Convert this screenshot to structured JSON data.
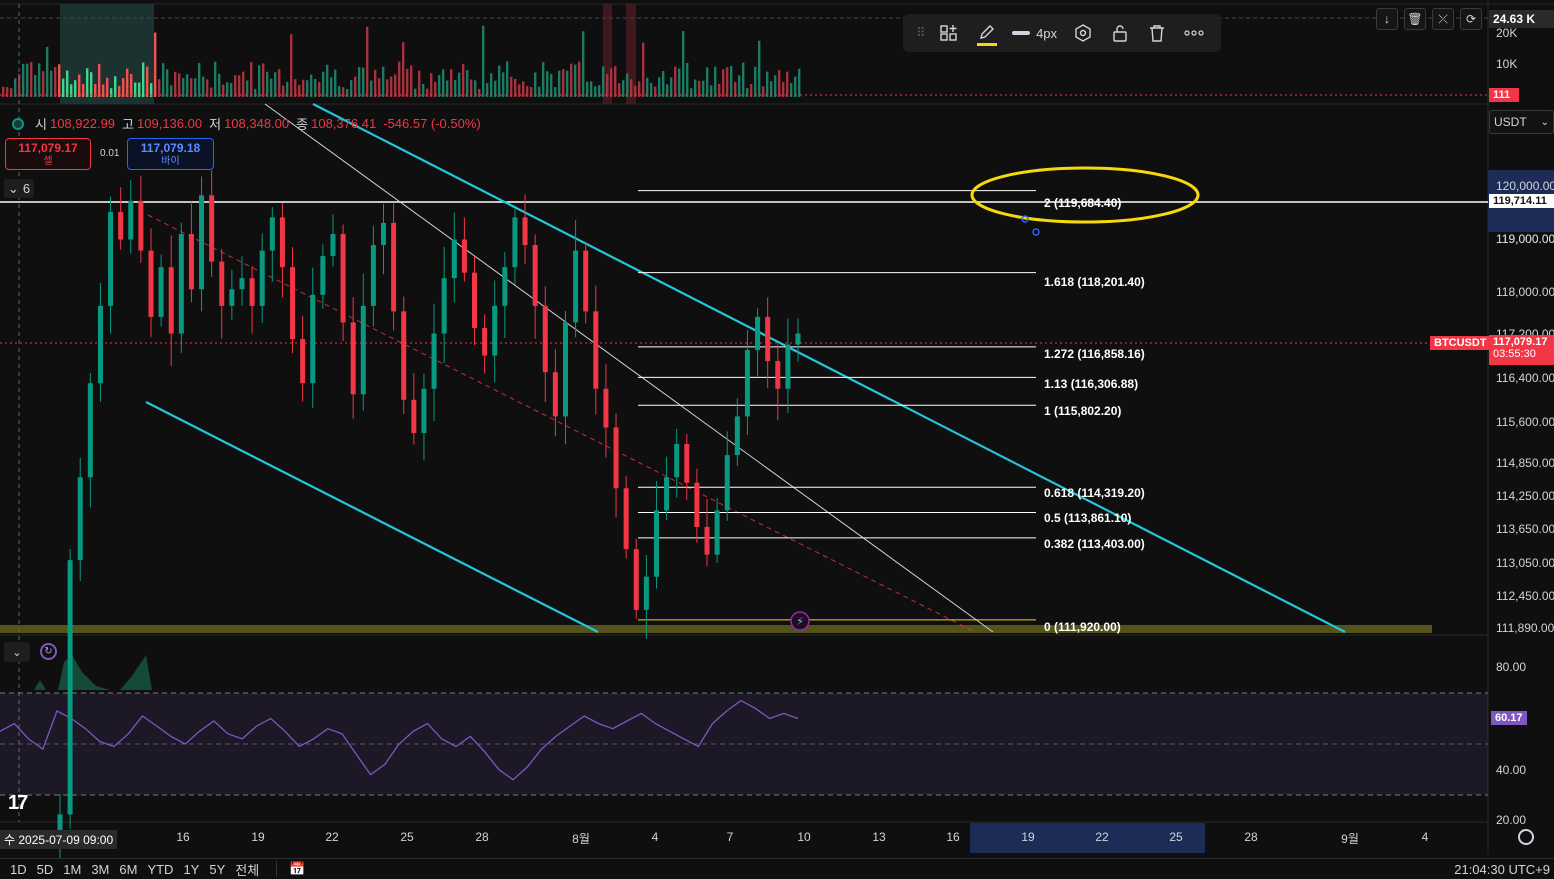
{
  "ohlc": {
    "open_label": "시",
    "open": "108,922.99",
    "high_label": "고",
    "high": "109,136.00",
    "low_label": "저",
    "low": "108,348.00",
    "close_label": "종",
    "close": "108,376.41",
    "change": "-546.57 (-0.50%)"
  },
  "trade": {
    "sell_price": "117,079.17",
    "sell_label": "셀",
    "spread": "0.01",
    "buy_price": "117,079.18",
    "buy_label": "바이"
  },
  "indicators_collapsed_count": "6",
  "drawing_toolbar": {
    "width_label": "4px",
    "tools": [
      "drag-handle",
      "template-icon",
      "pen-icon",
      "line-style-icon",
      "settings-icon",
      "lock-icon",
      "trash-icon",
      "more-icon"
    ]
  },
  "currency": "USDT",
  "symbol": "BTCUSDT",
  "last_price": "117,079.17",
  "countdown": "03:55:30",
  "crosshair_price": "119,714.11",
  "volume_axis": {
    "ticks": [
      "20K",
      "10K"
    ],
    "max_label": "24.63 K",
    "current_label": "111"
  },
  "price_axis_ticks": [
    "120,000.00",
    "119,000.00",
    "118,000.00",
    "117,200.00",
    "116,400.00",
    "115,600.00",
    "114,850.00",
    "114,250.00",
    "113,650.00",
    "113,050.00",
    "112,450.00",
    "111,890.00"
  ],
  "fib_levels": [
    {
      "label": "2 (119,684.40)",
      "price": 119684.4
    },
    {
      "label": "1.618 (118,201.40)",
      "price": 118201.4
    },
    {
      "label": "1.272 (116,858.16)",
      "price": 116858.16
    },
    {
      "label": "1.13 (116,306.88)",
      "price": 116306.88
    },
    {
      "label": "1 (115,802.20)",
      "price": 115802.2
    },
    {
      "label": "0.618 (114,319.20)",
      "price": 114319.2
    },
    {
      "label": "0.5 (113,861.10)",
      "price": 113861.1
    },
    {
      "label": "0.382 (113,403.00)",
      "price": 113403.0
    },
    {
      "label": "0 (111,920.00)",
      "price": 111920.0
    }
  ],
  "rsi": {
    "ticks": [
      "80.00",
      "40.00",
      "20.00"
    ],
    "value": "60.17"
  },
  "time_axis": {
    "cursor_label": "수 2025-07-09   09:00",
    "ticks": [
      "16",
      "19",
      "22",
      "25",
      "28",
      "8월",
      "4",
      "7",
      "10",
      "13",
      "16",
      "19",
      "22",
      "25",
      "28",
      "9월",
      "4"
    ]
  },
  "ranges": [
    "1D",
    "5D",
    "1M",
    "3M",
    "6M",
    "YTD",
    "1Y",
    "5Y",
    "전체"
  ],
  "clock": "21:04:30 UTC+9",
  "colors": {
    "up": "#089981",
    "down": "#f23645",
    "channel": "#26c6da",
    "annotation": "#f5d90a",
    "rsi": "#7e57c2"
  },
  "chart_data": {
    "type": "candlestick",
    "price_range": [
      111700,
      120600
    ],
    "candles_4h_close_approx": [
      108400,
      113000,
      114500,
      116200,
      117600,
      119300,
      118800,
      119500,
      118600,
      117400,
      118300,
      117100,
      118900,
      117900,
      119600,
      118400,
      117600,
      117900,
      118100,
      117600,
      118600,
      119200,
      118300,
      117000,
      116200,
      117800,
      118500,
      118900,
      117300,
      116000,
      117600,
      118700,
      119100,
      117500,
      115900,
      115300,
      116100,
      117100,
      118100,
      118800,
      118200,
      117200,
      116700,
      117600,
      118300,
      119200,
      118700,
      117600,
      116400,
      115600,
      117300,
      118600,
      117500,
      116100,
      115400,
      114300,
      113200,
      112100,
      112700,
      113900,
      114500,
      115100,
      114400,
      113600,
      113100,
      113900,
      114900,
      115600,
      116800,
      117400,
      116600,
      116100,
      116900,
      117100
    ],
    "rsi_values": [
      55,
      58,
      52,
      48,
      63,
      60,
      56,
      51,
      49,
      54,
      61,
      57,
      53,
      50,
      55,
      59,
      54,
      52,
      57,
      60,
      55,
      49,
      52,
      56,
      54,
      46,
      38,
      42,
      50,
      55,
      58,
      52,
      49,
      53,
      47,
      40,
      36,
      41,
      48,
      53,
      57,
      61,
      58,
      56,
      59,
      62,
      58,
      55,
      52,
      49,
      58,
      63,
      67,
      64,
      60,
      62,
      60
    ]
  }
}
